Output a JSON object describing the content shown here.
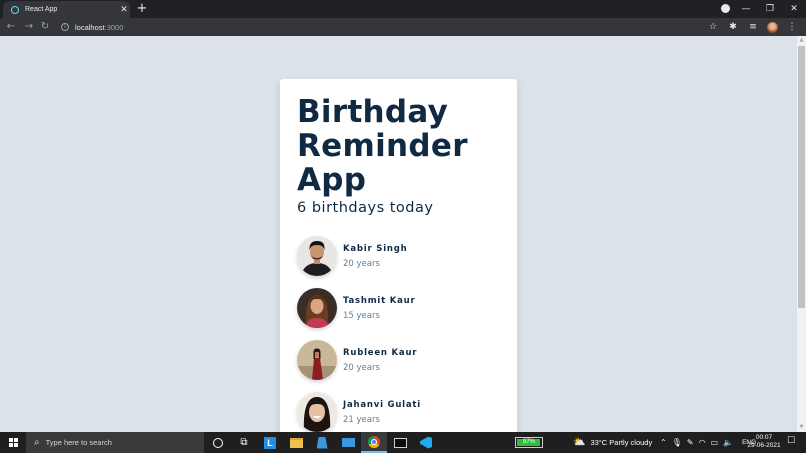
{
  "browser": {
    "tab_title": "React App",
    "tab_close": "✕",
    "new_tab": "+",
    "url_host": "localhost",
    "url_port": ":3000",
    "window_controls": [
      "—",
      "❐",
      "✕"
    ]
  },
  "app": {
    "title": "Birthday Reminder App",
    "subtitle": "6 birthdays today",
    "people": [
      {
        "name": "Kabir Singh",
        "age": "20 years",
        "photo": "man-portrait-photo"
      },
      {
        "name": "Tashmit Kaur",
        "age": "15 years",
        "photo": "woman-portrait-photo"
      },
      {
        "name": "Rubleen Kaur",
        "age": "20 years",
        "photo": "woman-red-dress-photo"
      },
      {
        "name": "Jahanvi Gulati",
        "age": "21 years",
        "photo": "woman-smiling-photo"
      }
    ]
  },
  "taskbar": {
    "search_placeholder": "Type here to search",
    "battery": "97%",
    "battery_level": 0.97,
    "weather": "33°C  Partly cloudy",
    "language": "ENG",
    "time": "00:07",
    "date": "29-06-2021"
  },
  "colors": {
    "page_bg": "#dbe2ea",
    "heading": "#102a43",
    "muted": "#627d98",
    "card": "#ffffff"
  }
}
